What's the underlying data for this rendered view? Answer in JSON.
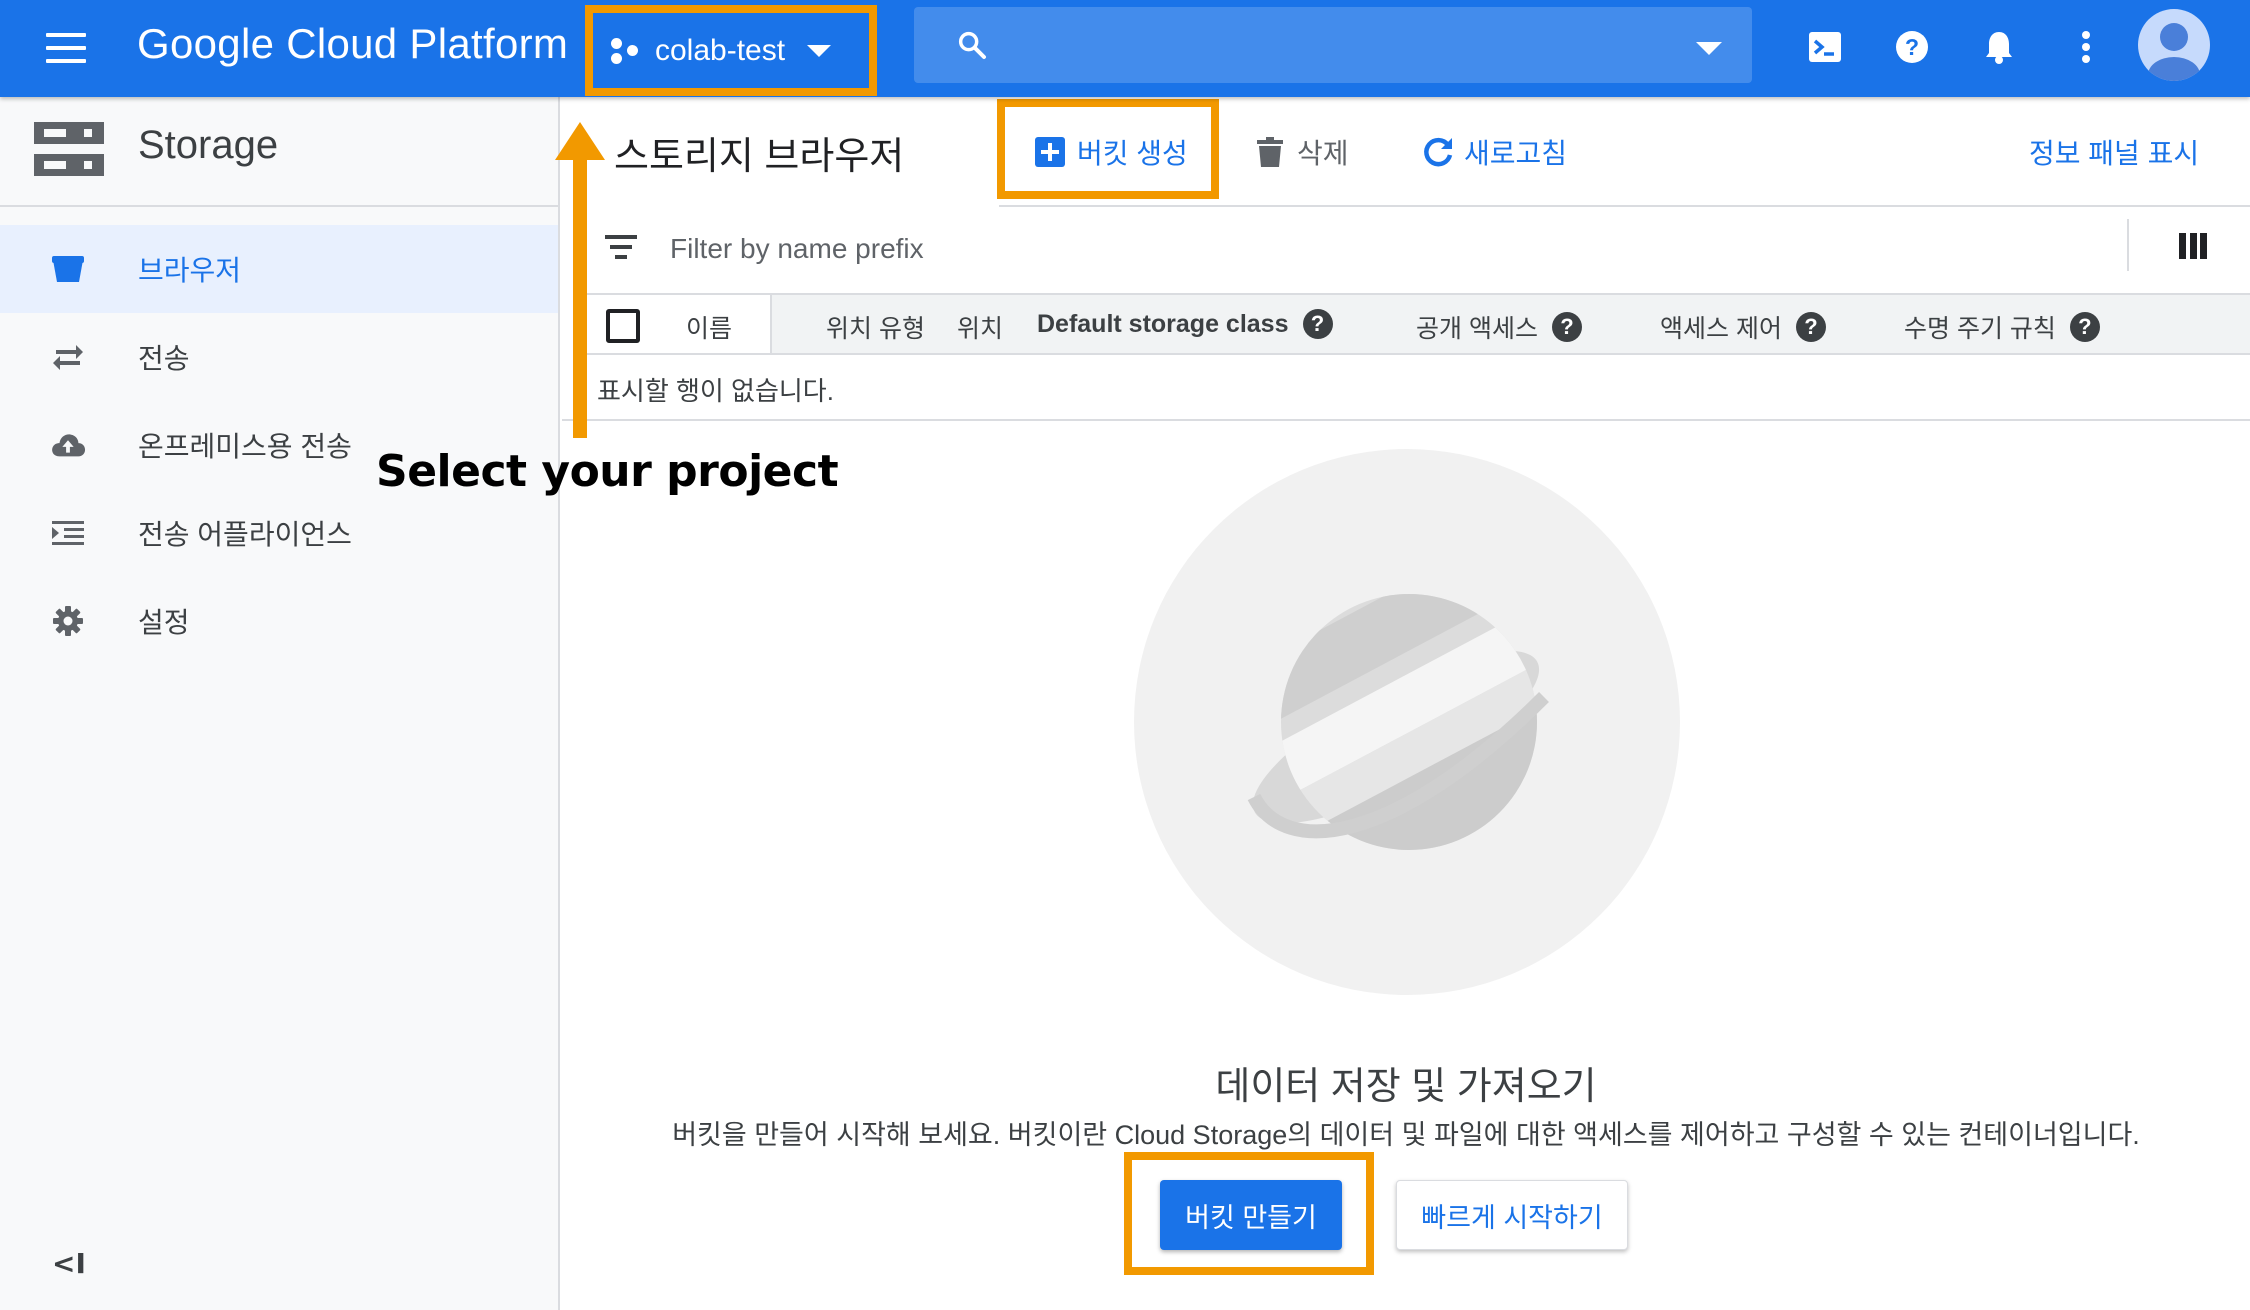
{
  "topbar": {
    "brand": "Google Cloud Platform",
    "project_name": "colab-test",
    "search_placeholder": ""
  },
  "sidebar": {
    "title": "Storage",
    "items": [
      {
        "label": "브라우저",
        "icon": "bucket-icon",
        "active": true
      },
      {
        "label": "전송",
        "icon": "swap-arrows-icon",
        "active": false
      },
      {
        "label": "온프레미스용 전송",
        "icon": "cloud-upload-icon",
        "active": false
      },
      {
        "label": "전송 어플라이언스",
        "icon": "list-indent-icon",
        "active": false
      },
      {
        "label": "설정",
        "icon": "gear-icon",
        "active": false
      }
    ],
    "collapse_label": "<I"
  },
  "main": {
    "page_title": "스토리지 브라우저",
    "toolbar": {
      "create_bucket": "버킷 생성",
      "delete": "삭제",
      "refresh": "새로고침",
      "info_panel": "정보 패널 표시"
    },
    "filter_placeholder": "Filter by name prefix",
    "columns": {
      "name": "이름",
      "location_type": "위치 유형",
      "location": "위치",
      "storage_class": "Default storage class",
      "public_access": "공개 액세스",
      "access_control": "액세스 제어",
      "lifecycle": "수명 주기 규칙"
    },
    "empty_row": "표시할 행이 없습니다.",
    "empty_state": {
      "title": "데이터 저장 및 가져오기",
      "subtitle": "버킷을 만들어 시작해 보세요. 버킷이란 Cloud Storage의 데이터 및 파일에 대한 액세스를 제어하고 구성할 수 있는 컨테이너입니다.",
      "primary_button": "버킷 만들기",
      "secondary_button": "빠르게 시작하기"
    }
  },
  "annotation": {
    "text": "Select your project"
  },
  "colors": {
    "brand_blue": "#1a73e8",
    "highlight_orange": "#f29900"
  }
}
